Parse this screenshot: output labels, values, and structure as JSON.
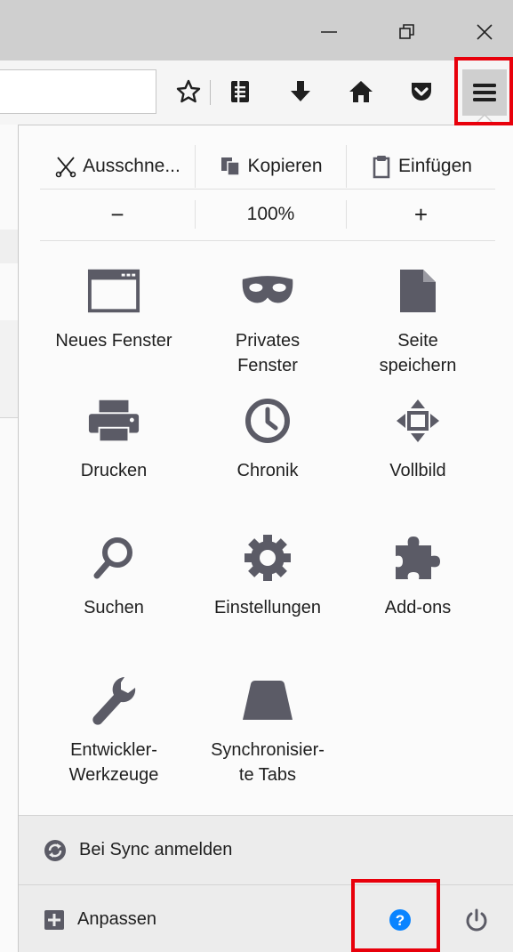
{
  "window": {
    "controls": {
      "minimize_icon": "minimize-icon",
      "restore_icon": "restore-icon",
      "close_icon": "close-icon"
    }
  },
  "toolbar": {
    "icons": [
      "star-icon",
      "reader-list-icon",
      "download-icon",
      "home-icon",
      "pocket-icon",
      "hamburger-menu-icon"
    ]
  },
  "menu": {
    "edit": {
      "cut": "Ausschne...",
      "copy": "Kopieren",
      "paste": "Einfügen"
    },
    "zoom": {
      "out": "−",
      "level": "100%",
      "in": "+"
    },
    "items": [
      {
        "label": "Neues Fenster",
        "icon": "window-icon"
      },
      {
        "label": "Privates\nFenster",
        "icon": "mask-icon"
      },
      {
        "label": "Seite\nspeichern",
        "icon": "page-icon"
      },
      {
        "label": "Drucken",
        "icon": "printer-icon"
      },
      {
        "label": "Chronik",
        "icon": "clock-icon"
      },
      {
        "label": "Vollbild",
        "icon": "fullscreen-icon"
      },
      {
        "label": "Suchen",
        "icon": "search-icon"
      },
      {
        "label": "Einstellungen",
        "icon": "gear-icon"
      },
      {
        "label": "Add-ons",
        "icon": "puzzle-icon"
      },
      {
        "label": "Entwickler-\nWerkzeuge",
        "icon": "wrench-icon"
      },
      {
        "label": "Synchronisier-\nte Tabs",
        "icon": "synced-tabs-icon"
      }
    ],
    "footer": {
      "sync": "Bei Sync anmelden",
      "customize": "Anpassen"
    }
  },
  "colors": {
    "icon_gray": "#5b5b66",
    "highlight": "#e8000b",
    "help_blue": "#0a84ff",
    "titlebar": "#cfcfcf",
    "footer": "#ececec"
  }
}
